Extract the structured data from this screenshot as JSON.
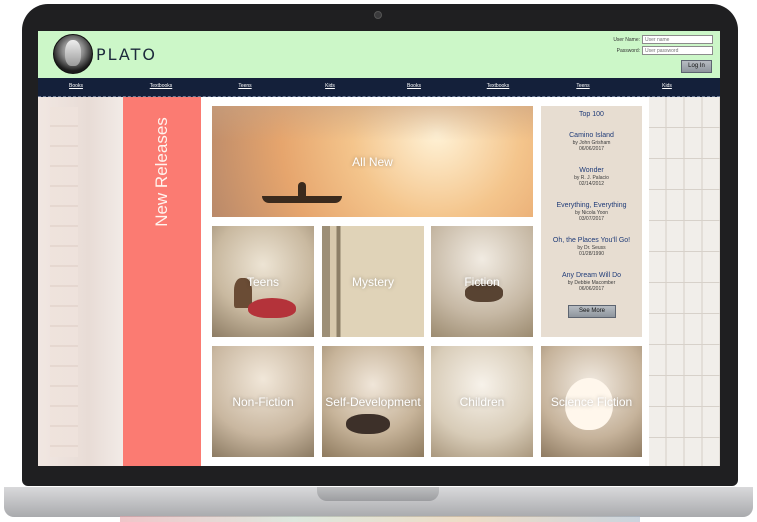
{
  "app": {
    "logo_text": "PLATO"
  },
  "login": {
    "user_label": "User Name:",
    "user_placeholder": "User name",
    "password_label": "Password:",
    "password_placeholder": "User password",
    "login_button": "Log In"
  },
  "nav": {
    "links": [
      "Books",
      "Textbooks",
      "Teens",
      "Kids",
      "Books",
      "Textbooks",
      "Teens",
      "Kids"
    ]
  },
  "side_banner": "New Releases",
  "tiles": {
    "all_new": "All New",
    "teens": "Teens",
    "mystery": "Mystery",
    "fiction": "Fiction",
    "nonfiction": "Non-Fiction",
    "self_development": "Self-Development",
    "children": "Children",
    "science_fiction": "Science Fiction"
  },
  "top100": {
    "title": "Top 100",
    "items": [
      {
        "title": "Camino Island",
        "author": "by John Grisham",
        "date": "06/06/2017"
      },
      {
        "title": "Wonder",
        "author": "by R. J. Palacio",
        "date": "02/14/2012"
      },
      {
        "title": "Everything, Everything",
        "author": "by Nicola Yoon",
        "date": "03/07/2017"
      },
      {
        "title": "Oh, the Places You'll Go!",
        "author": "by Dr. Seuss",
        "date": "01/28/1990"
      },
      {
        "title": "Any Dream Will Do",
        "author": "by Debbie Macomber",
        "date": "06/06/2017"
      }
    ],
    "see_more": "See More"
  },
  "colors": {
    "header_bg": "#ccf7c8",
    "nav_bg": "#14203a",
    "side_band": "#fb7b72",
    "top_panel_bg": "#e7ddd1",
    "link_blue": "#1f3b78"
  }
}
